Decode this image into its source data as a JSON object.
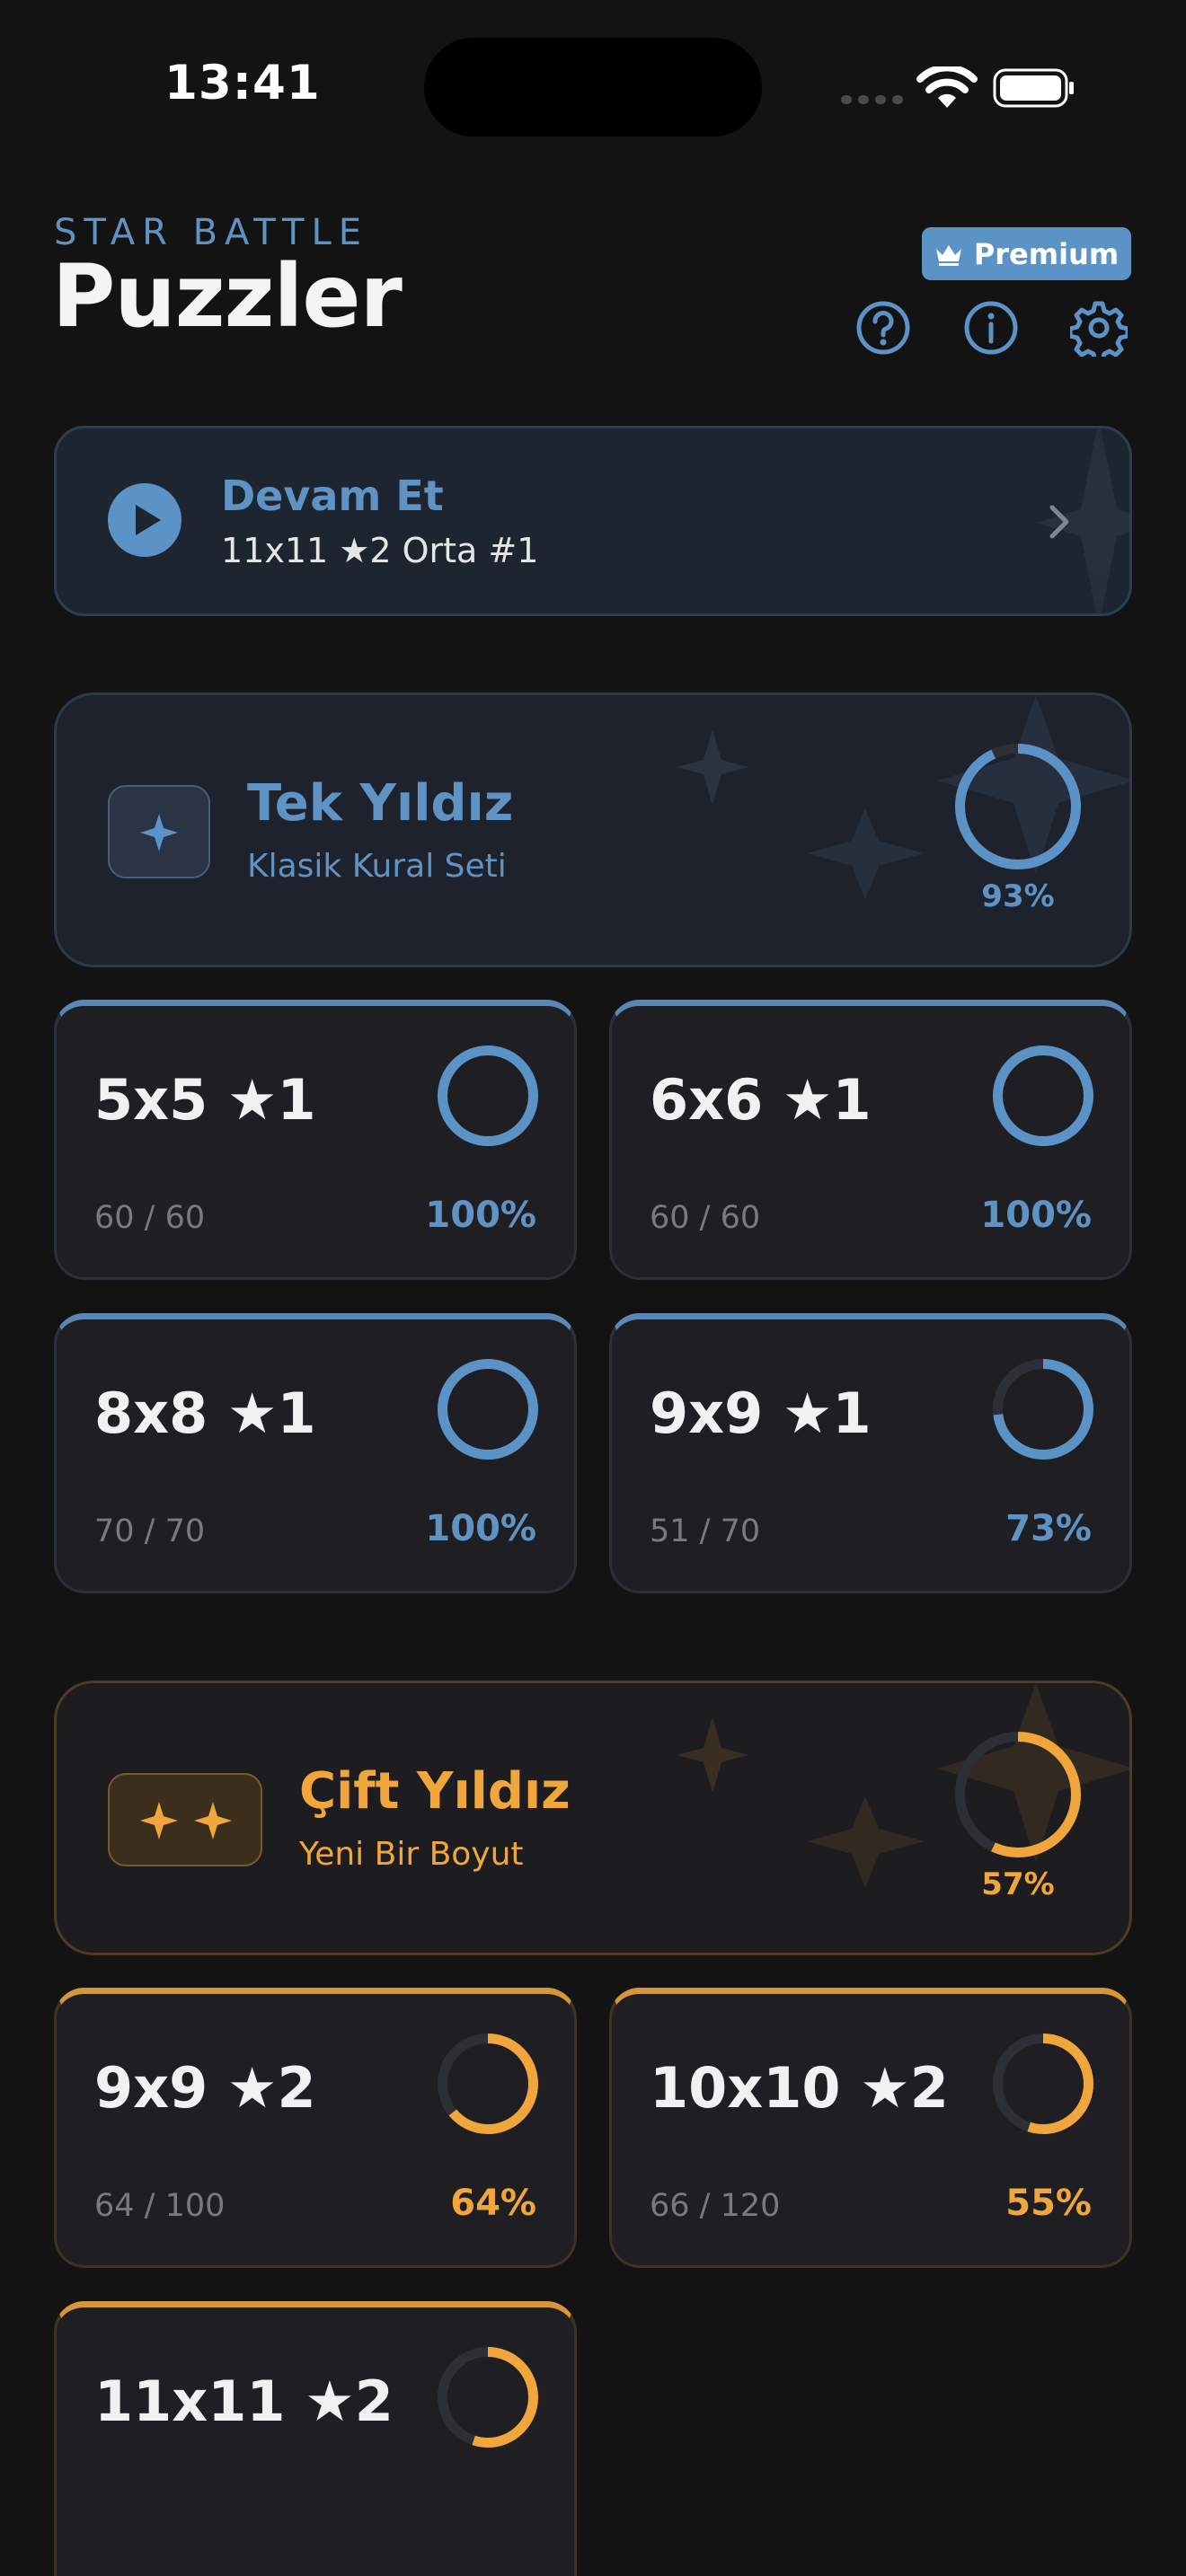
{
  "status_bar": {
    "time": "13:41"
  },
  "header": {
    "eyebrow": "STAR BATTLE",
    "title": "Puzzler",
    "premium_label": "Premium"
  },
  "continue_card": {
    "title": "Devam Et",
    "subtitle": "11x11 ★2  Orta #1"
  },
  "sections": [
    {
      "title": "Tek Yıldız",
      "subtitle": "Klasik Kural Seti",
      "percent_label": "93%",
      "progress": 0.93,
      "accent": "#5b93c7",
      "levels": [
        {
          "label": "5x5 ★1",
          "count": "60 / 60",
          "percent_label": "100%",
          "progress": 1.0
        },
        {
          "label": "6x6 ★1",
          "count": "60 / 60",
          "percent_label": "100%",
          "progress": 1.0
        },
        {
          "label": "8x8 ★1",
          "count": "70 / 70",
          "percent_label": "100%",
          "progress": 1.0
        },
        {
          "label": "9x9 ★1",
          "count": "51 / 70",
          "percent_label": "73%",
          "progress": 0.73
        }
      ]
    },
    {
      "title": "Çift Yıldız",
      "subtitle": "Yeni Bir Boyut",
      "percent_label": "57%",
      "progress": 0.57,
      "accent": "#f0a63a",
      "levels": [
        {
          "label": "9x9 ★2",
          "count": "64 / 100",
          "percent_label": "64%",
          "progress": 0.64
        },
        {
          "label": "10x10 ★2",
          "count": "66 / 120",
          "percent_label": "55%",
          "progress": 0.55
        },
        {
          "label": "11x11 ★2",
          "count": "",
          "percent_label": "",
          "progress": 0.55
        }
      ]
    }
  ],
  "icons": {
    "help": "question-circle-icon",
    "info": "info-circle-icon",
    "settings": "gear-icon",
    "premium": "crown-icon",
    "continue": "play-icon",
    "single": "four-point-star-icon",
    "double": "two-star-icon"
  }
}
